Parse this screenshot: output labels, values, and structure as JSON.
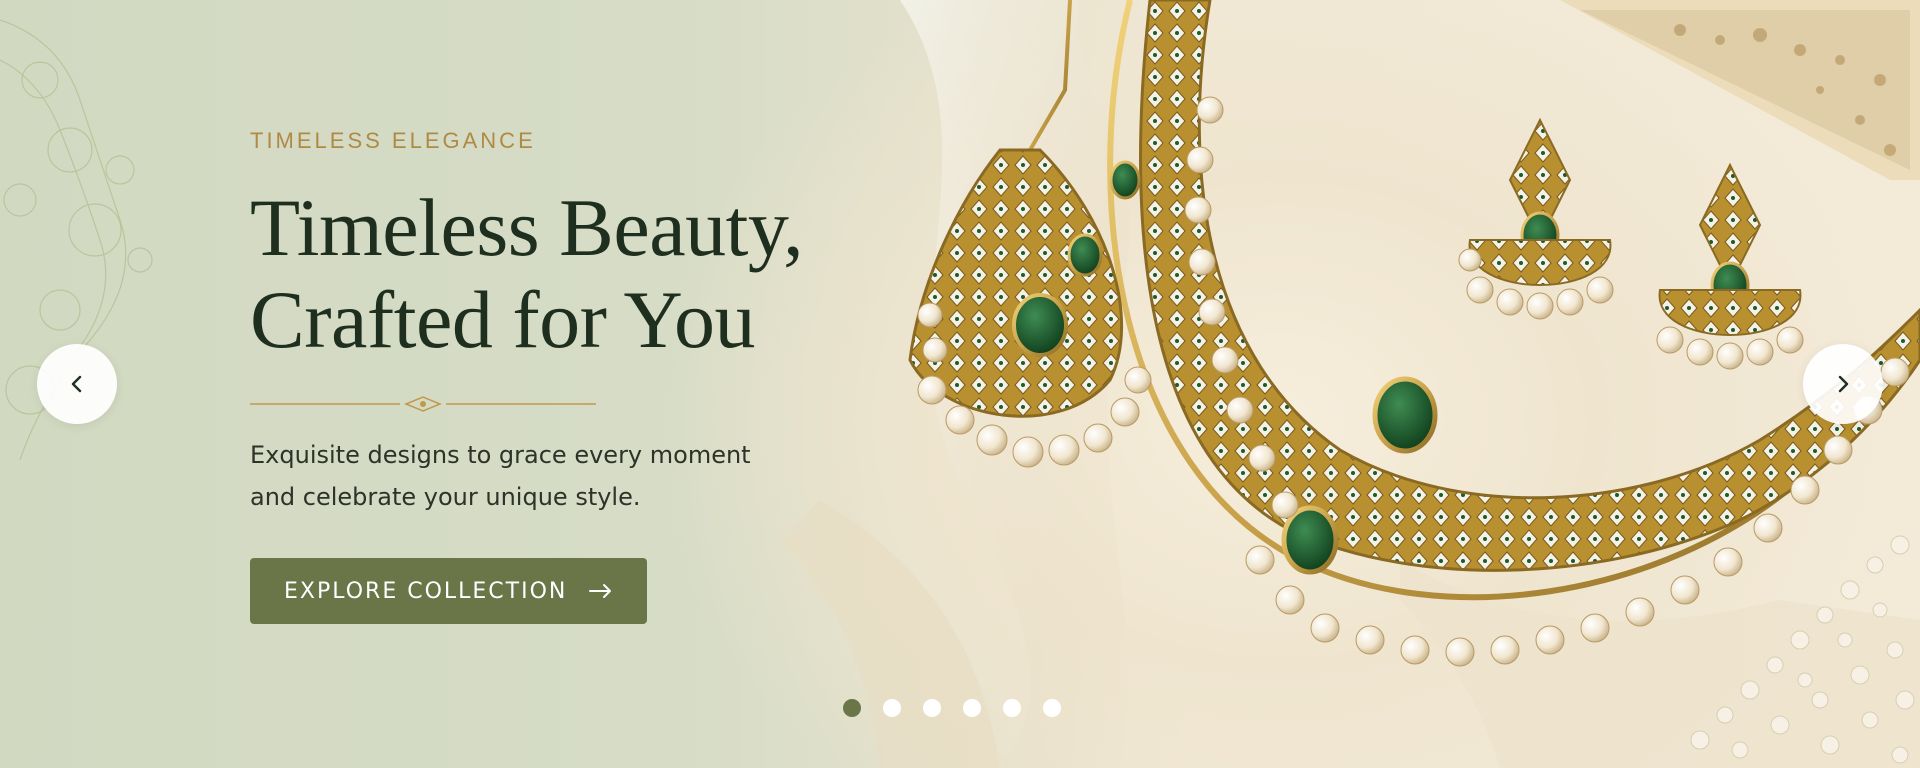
{
  "hero": {
    "eyebrow": "TIMELESS ELEGANCE",
    "headline_line1": "Timeless Beauty,",
    "headline_line2": "Crafted for You",
    "subtext_line1": "Exquisite designs to grace every moment",
    "subtext_line2": "and celebrate your unique style.",
    "cta_label": "EXPLORE COLLECTION",
    "cta_icon": "arrow-right-icon"
  },
  "carousel": {
    "prev_icon": "chevron-left-icon",
    "next_icon": "chevron-right-icon",
    "slide_count": 6,
    "active_slide": 1
  },
  "colors": {
    "accent": "#6a7548",
    "eyebrow": "#b08a45",
    "headline": "#1f2f1f",
    "gold": "#c9a24a",
    "emerald": "#1e5a2c"
  }
}
